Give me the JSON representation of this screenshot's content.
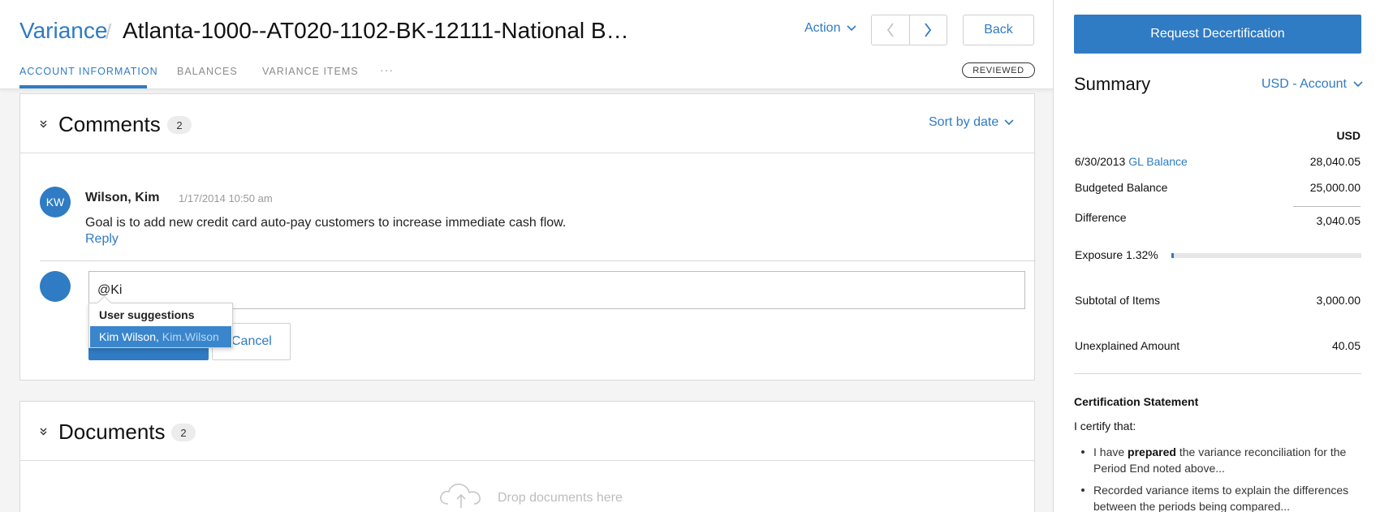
{
  "header": {
    "breadcrumb_root": "Variance",
    "breadcrumb_separator": "/",
    "title": "Atlanta-1000--AT020-1102-BK-12111-National B…",
    "action_label": "Action",
    "back_label": "Back",
    "tabs": [
      {
        "label": "ACCOUNT INFORMATION",
        "active": true
      },
      {
        "label": "BALANCES",
        "active": false
      },
      {
        "label": "VARIANCE ITEMS",
        "active": false
      }
    ],
    "more_label": "···",
    "status_badge": "REVIEWED"
  },
  "comments": {
    "title": "Comments",
    "count": "2",
    "sort_label": "Sort by date",
    "items": [
      {
        "initials": "KW",
        "author": "Wilson, Kim",
        "timestamp": "1/17/2014 10:50 am",
        "body": "Goal is to add new credit card auto-pay customers to increase immediate cash flow.",
        "reply_label": "Reply"
      }
    ],
    "compose": {
      "value": "@Ki",
      "cancel_label": "Cancel"
    },
    "suggestions": {
      "heading": "User suggestions",
      "items": [
        {
          "name": "Kim Wilson,",
          "username": "Kim.Wilson"
        }
      ]
    }
  },
  "documents": {
    "title": "Documents",
    "count": "2",
    "drop_text": "Drop documents here"
  },
  "side": {
    "request_label": "Request Decertification",
    "summary_title": "Summary",
    "currency_selector": "USD - Account",
    "column_header": "USD",
    "rows": {
      "gl_date": "6/30/2013",
      "gl_link": "GL Balance",
      "gl_value": "28,040.05",
      "budgeted_label": "Budgeted Balance",
      "budgeted_value": "25,000.00",
      "difference_label": "Difference",
      "difference_value": "3,040.05",
      "exposure_label": "Exposure 1.32%",
      "exposure_percent": 1.32,
      "subtotal_label": "Subtotal of Items",
      "subtotal_value": "3,000.00",
      "unexplained_label": "Unexplained Amount",
      "unexplained_value": "40.05"
    },
    "certification": {
      "title": "Certification Statement",
      "intro": "I certify that:",
      "item1_pre": "I have ",
      "item1_bold": "prepared",
      "item1_post": " the variance reconciliation for the Period End noted above...",
      "item2": "Recorded variance items to explain the differences between the periods being compared..."
    }
  },
  "colors": {
    "accent": "#2f7bc4",
    "text": "#222222",
    "muted": "#9a9a9a",
    "background": "#f4f4f4"
  }
}
